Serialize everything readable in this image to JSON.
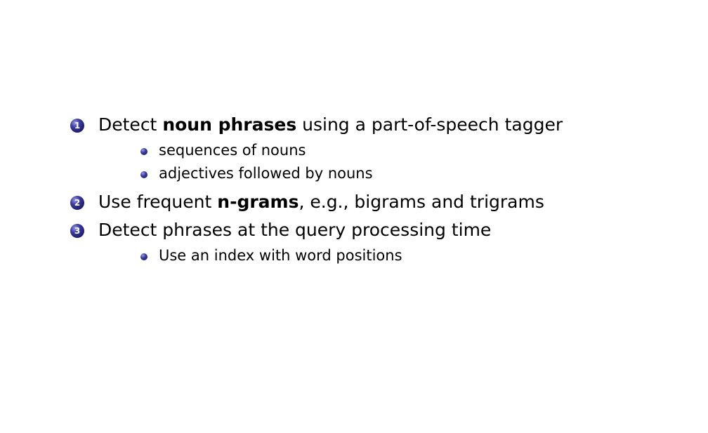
{
  "items": [
    {
      "number": "1",
      "before": "Detect ",
      "bold": "noun phrases",
      "after": " using a part-of-speech tagger",
      "subitems": [
        "sequences of nouns",
        "adjectives followed by nouns"
      ]
    },
    {
      "number": "2",
      "before": "Use frequent ",
      "bold": "n-grams",
      "after": ", e.g., bigrams and trigrams",
      "subitems": []
    },
    {
      "number": "3",
      "before": "Detect phrases at the query processing time",
      "bold": "",
      "after": "",
      "subitems": [
        "Use an index with word positions"
      ]
    }
  ]
}
